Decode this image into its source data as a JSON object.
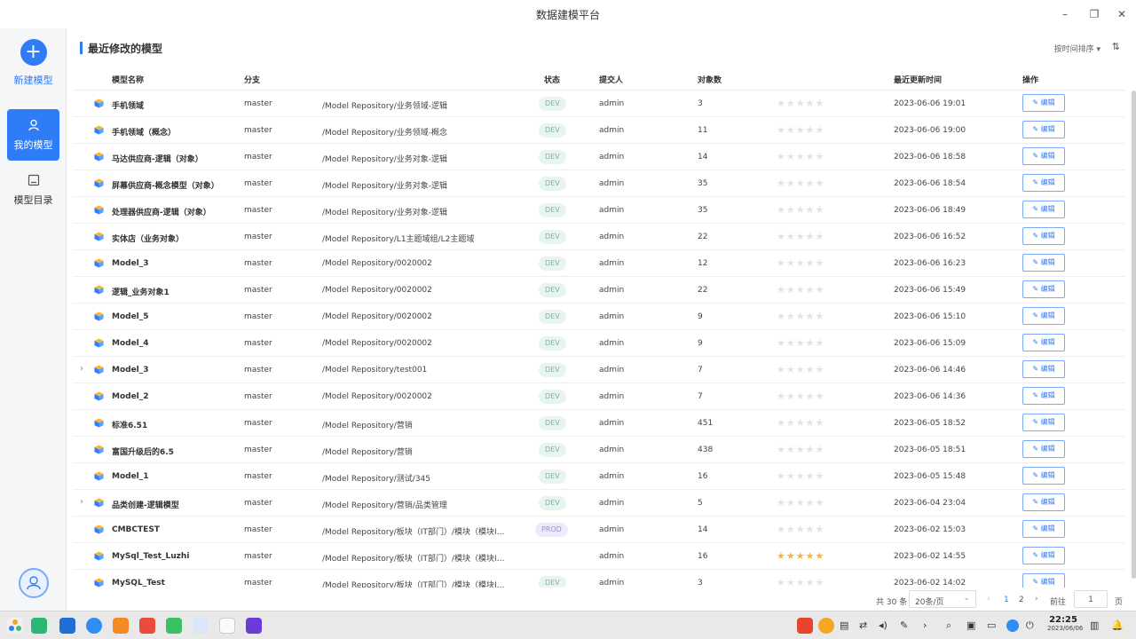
{
  "window": {
    "title": "数据建模平台",
    "minimize": "–",
    "restore": "❐",
    "close": "✕"
  },
  "sidebar": {
    "new_model": "新建模型",
    "my_models": "我的模型",
    "catalog": "模型目录"
  },
  "section_title": "最近修改的模型",
  "sort_label": "按时间排序 ▾",
  "columns": {
    "name": "模型名称",
    "branch": "分支",
    "status": "状态",
    "submitter": "提交人",
    "objects": "对象数",
    "updated": "最近更新时间",
    "action": "操作"
  },
  "rows": [
    {
      "name": "手机领域",
      "branch": "master",
      "path": "/Model Repository/业务领域-逻辑",
      "status": "DEV",
      "submitter": "admin",
      "objects": "3",
      "stars": "★★★★★",
      "updated": "2023-06-06 19:01",
      "action": "编辑",
      "expand": ""
    },
    {
      "name": "手机领域（概念）",
      "branch": "master",
      "path": "/Model Repository/业务领域-概念",
      "status": "DEV",
      "submitter": "admin",
      "objects": "11",
      "stars": "★★★★★",
      "updated": "2023-06-06 19:00",
      "action": "编辑",
      "expand": ""
    },
    {
      "name": "马达供应商-逻辑（对象）",
      "branch": "master",
      "path": "/Model Repository/业务对象-逻辑",
      "status": "DEV",
      "submitter": "admin",
      "objects": "14",
      "stars": "★★★★★",
      "updated": "2023-06-06 18:58",
      "action": "编辑",
      "expand": ""
    },
    {
      "name": "屏幕供应商-概念模型（对象）",
      "branch": "master",
      "path": "/Model Repository/业务对象-逻辑",
      "status": "DEV",
      "submitter": "admin",
      "objects": "35",
      "stars": "★★★★★",
      "updated": "2023-06-06 18:54",
      "action": "编辑",
      "expand": ""
    },
    {
      "name": "处理器供应商-逻辑（对象）",
      "branch": "master",
      "path": "/Model Repository/业务对象-逻辑",
      "status": "DEV",
      "submitter": "admin",
      "objects": "35",
      "stars": "★★★★★",
      "updated": "2023-06-06 18:49",
      "action": "编辑",
      "expand": ""
    },
    {
      "name": "实体店（业务对象）",
      "branch": "master",
      "path": "/Model Repository/L1主题域组/L2主题域",
      "status": "DEV",
      "submitter": "admin",
      "objects": "22",
      "stars": "★★★★★",
      "updated": "2023-06-06 16:52",
      "action": "编辑",
      "expand": ""
    },
    {
      "name": "Model_3",
      "branch": "master",
      "path": "/Model Repository/0020002",
      "status": "DEV",
      "submitter": "admin",
      "objects": "12",
      "stars": "★★★★★",
      "updated": "2023-06-06 16:23",
      "action": "编辑",
      "expand": ""
    },
    {
      "name": "逻辑_业务对象1",
      "branch": "master",
      "path": "/Model Repository/0020002",
      "status": "DEV",
      "submitter": "admin",
      "objects": "22",
      "stars": "★★★★★",
      "updated": "2023-06-06 15:49",
      "action": "编辑",
      "expand": ""
    },
    {
      "name": "Model_5",
      "branch": "master",
      "path": "/Model Repository/0020002",
      "status": "DEV",
      "submitter": "admin",
      "objects": "9",
      "stars": "★★★★★",
      "updated": "2023-06-06 15:10",
      "action": "编辑",
      "expand": ""
    },
    {
      "name": "Model_4",
      "branch": "master",
      "path": "/Model Repository/0020002",
      "status": "DEV",
      "submitter": "admin",
      "objects": "9",
      "stars": "★★★★★",
      "updated": "2023-06-06 15:09",
      "action": "编辑",
      "expand": ""
    },
    {
      "name": "Model_3",
      "branch": "master",
      "path": "/Model Repository/test001",
      "status": "DEV",
      "submitter": "admin",
      "objects": "7",
      "stars": "★★★★★",
      "updated": "2023-06-06 14:46",
      "action": "编辑",
      "expand": "›"
    },
    {
      "name": "Model_2",
      "branch": "master",
      "path": "/Model Repository/0020002",
      "status": "DEV",
      "submitter": "admin",
      "objects": "7",
      "stars": "★★★★★",
      "updated": "2023-06-06 14:36",
      "action": "编辑",
      "expand": ""
    },
    {
      "name": "标准6.51",
      "branch": "master",
      "path": "/Model Repository/营销",
      "status": "DEV",
      "submitter": "admin",
      "objects": "451",
      "stars": "★★★★★",
      "updated": "2023-06-05 18:52",
      "action": "编辑",
      "expand": ""
    },
    {
      "name": "富国升级后的6.5",
      "branch": "master",
      "path": "/Model Repository/营销",
      "status": "DEV",
      "submitter": "admin",
      "objects": "438",
      "stars": "★★★★★",
      "updated": "2023-06-05 18:51",
      "action": "编辑",
      "expand": ""
    },
    {
      "name": "Model_1",
      "branch": "master",
      "path": "/Model Repository/测试/345",
      "status": "DEV",
      "submitter": "admin",
      "objects": "16",
      "stars": "★★★★★",
      "updated": "2023-06-05 15:48",
      "action": "编辑",
      "expand": ""
    },
    {
      "name": "品类创建-逻辑模型",
      "branch": "master",
      "path": "/Model Repository/营销/品类管理",
      "status": "DEV",
      "submitter": "admin",
      "objects": "5",
      "stars": "★★★★★",
      "updated": "2023-06-04 23:04",
      "action": "编辑",
      "expand": "›"
    },
    {
      "name": "CMBCTEST",
      "branch": "master",
      "path": "/Model Repository/板块（IT部门）/模块（模块I…",
      "status": "PROD",
      "submitter": "admin",
      "objects": "14",
      "stars": "★★★★★",
      "updated": "2023-06-02 15:03",
      "action": "编辑",
      "expand": ""
    },
    {
      "name": "MySql_Test_Luzhi",
      "branch": "master",
      "path": "/Model Repository/板块（IT部门）/模块（模块I…",
      "status": "",
      "submitter": "admin",
      "objects": "16",
      "stars": "★★★★★",
      "stars_on": true,
      "updated": "2023-06-02 14:55",
      "action": "编辑",
      "expand": ""
    },
    {
      "name": "MySQL_Test",
      "branch": "master",
      "path": "/Model Repository/板块（IT部门）/模块（模块I…",
      "status": "DEV",
      "submitter": "admin",
      "objects": "3",
      "stars": "★★★★★",
      "updated": "2023-06-02 14:02",
      "action": "编辑",
      "expand": ""
    }
  ],
  "pager": {
    "total": "共 30 条",
    "page_size": "20条/页",
    "prev": "‹",
    "page1": "1",
    "page2": "2",
    "next": "›",
    "goto": "前往",
    "goto_value": "1",
    "page_word": "页"
  },
  "taskbar": {
    "time": "22:25",
    "date": "2023/06/06"
  },
  "colors": {
    "accent": "#2f7cf6",
    "dev_badge": "#e8f4f0",
    "prod_badge": "#eeeafb",
    "star_on": "#f5b82e"
  }
}
